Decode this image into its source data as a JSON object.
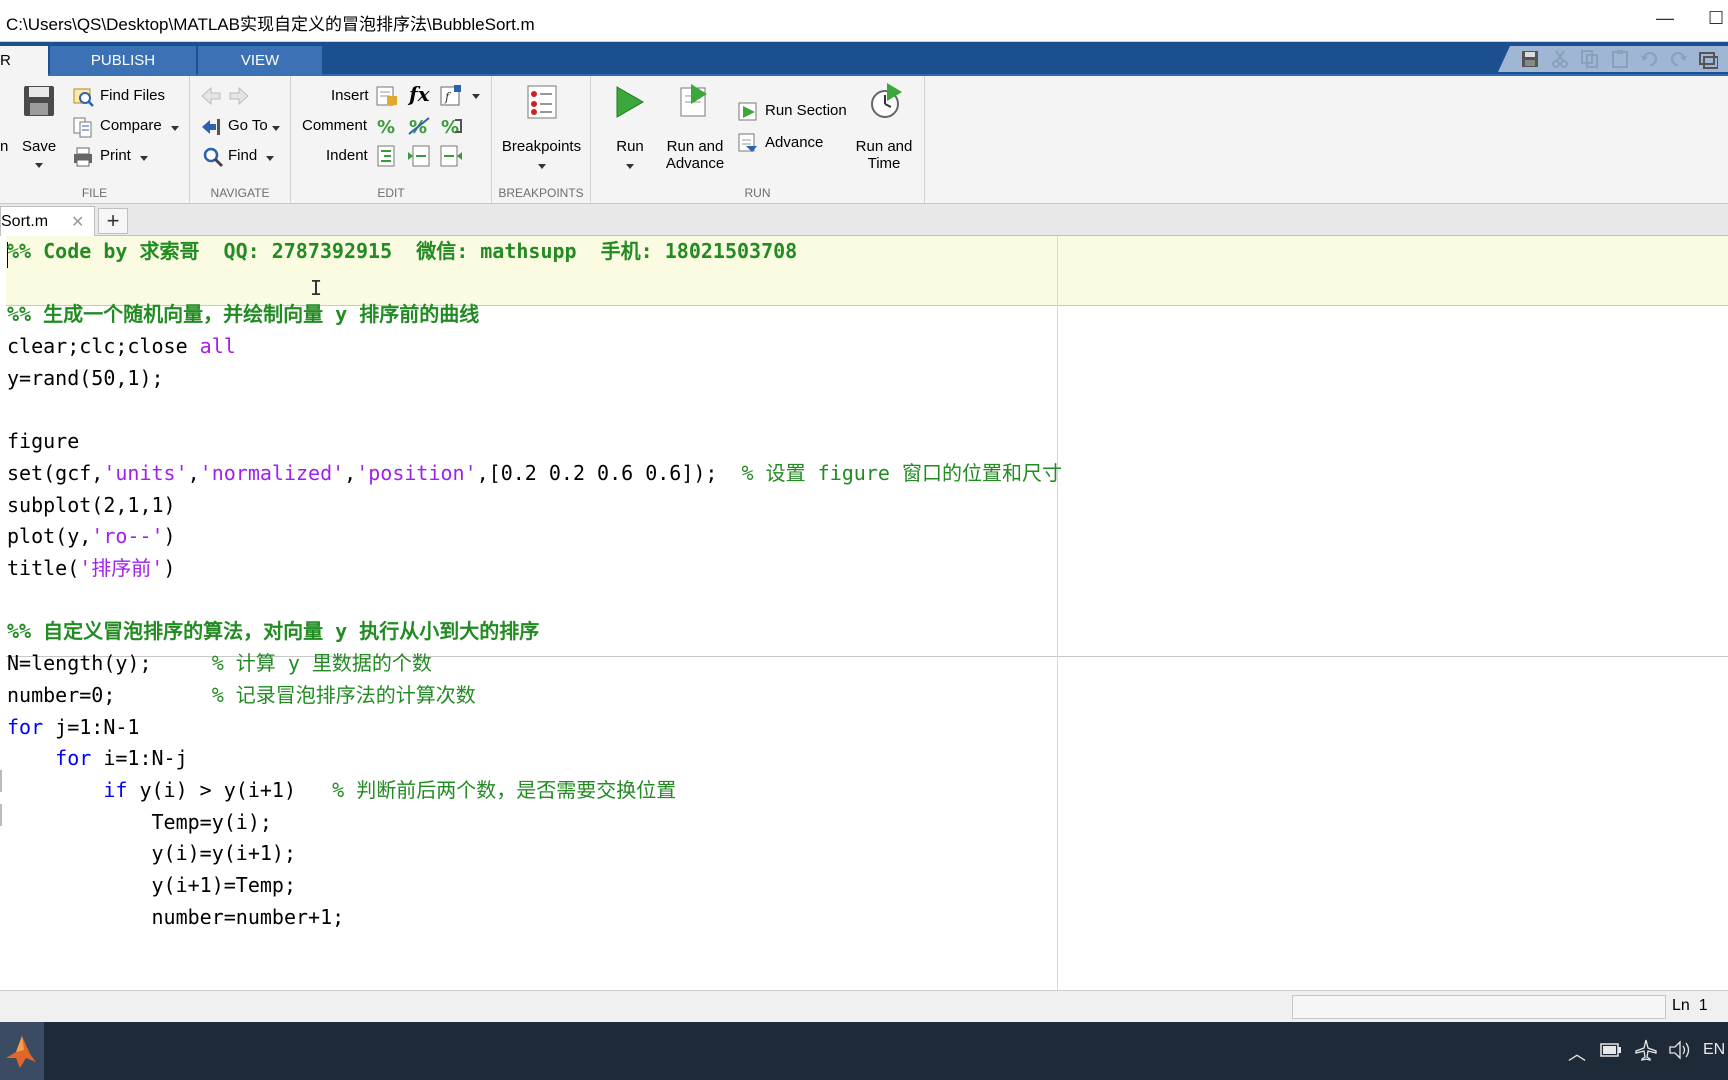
{
  "window": {
    "title": "C:\\Users\\QS\\Desktop\\MATLAB实现自定义的冒泡排序法\\BubbleSort.m",
    "minimize_glyph": "—",
    "maximize_glyph": "☐"
  },
  "ribbon": {
    "tabs": [
      {
        "label": "R",
        "active": true
      },
      {
        "label": "PUBLISH",
        "active": false
      },
      {
        "label": "VIEW",
        "active": false
      }
    ]
  },
  "toolstrip": {
    "file": {
      "label": "FILE",
      "cut_label": "n",
      "save": "Save",
      "find_files": "Find Files",
      "compare": "Compare",
      "print": "Print"
    },
    "navigate": {
      "label": "NAVIGATE",
      "go_to": "Go To",
      "find": "Find"
    },
    "edit": {
      "label": "EDIT",
      "insert": "Insert",
      "comment": "Comment",
      "indent": "Indent",
      "fx": "fx"
    },
    "breakpoints": {
      "label": "BREAKPOINTS",
      "breakpoints": "Breakpoints"
    },
    "run": {
      "label": "RUN",
      "run": "Run",
      "run_and_advance_1": "Run and",
      "run_and_advance_2": "Advance",
      "run_section": "Run Section",
      "advance": "Advance",
      "run_and_time_1": "Run and",
      "run_and_time_2": "Time"
    }
  },
  "editor": {
    "file_tab": "Sort.m",
    "close_glyph": "✕",
    "add_glyph": "+",
    "ibeam_glyph": "I",
    "lines": [
      {
        "segments": [
          {
            "t": "%% Code by 求索哥  QQ: 2787392915  微信: mathsupp  手机: 18021503708",
            "c": "cell"
          }
        ]
      },
      {
        "segments": []
      },
      {
        "segments": [
          {
            "t": "%% 生成一个随机向量，并绘制向量 y 排序前的曲线",
            "c": "cell"
          }
        ]
      },
      {
        "segments": [
          {
            "t": "clear;clc;close ",
            "c": ""
          },
          {
            "t": "all",
            "c": "str"
          }
        ]
      },
      {
        "segments": [
          {
            "t": "y=rand(50,1);",
            "c": ""
          }
        ]
      },
      {
        "segments": []
      },
      {
        "segments": [
          {
            "t": "figure",
            "c": ""
          }
        ]
      },
      {
        "segments": [
          {
            "t": "set(gcf,",
            "c": ""
          },
          {
            "t": "'units'",
            "c": "str"
          },
          {
            "t": ",",
            "c": ""
          },
          {
            "t": "'normalized'",
            "c": "str"
          },
          {
            "t": ",",
            "c": ""
          },
          {
            "t": "'position'",
            "c": "str"
          },
          {
            "t": ",[0.2 0.2 0.6 0.6]);  ",
            "c": ""
          },
          {
            "t": "% 设置 figure 窗口的位置和尺寸",
            "c": "cm"
          }
        ]
      },
      {
        "segments": [
          {
            "t": "subplot(2,1,1)",
            "c": ""
          }
        ]
      },
      {
        "segments": [
          {
            "t": "plot(y,",
            "c": ""
          },
          {
            "t": "'ro--'",
            "c": "str"
          },
          {
            "t": ")",
            "c": ""
          }
        ]
      },
      {
        "segments": [
          {
            "t": "title(",
            "c": ""
          },
          {
            "t": "'排序前'",
            "c": "str"
          },
          {
            "t": ")",
            "c": ""
          }
        ]
      },
      {
        "segments": []
      },
      {
        "segments": [
          {
            "t": "%% 自定义冒泡排序的算法，对向量 y 执行从小到大的排序",
            "c": "cell"
          }
        ]
      },
      {
        "segments": [
          {
            "t": "N=length(y);     ",
            "c": ""
          },
          {
            "t": "% 计算 y 里数据的个数",
            "c": "cm"
          }
        ]
      },
      {
        "segments": [
          {
            "t": "number=0;        ",
            "c": ""
          },
          {
            "t": "% 记录冒泡排序法的计算次数",
            "c": "cm"
          }
        ]
      },
      {
        "segments": [
          {
            "t": "for",
            "c": "kw"
          },
          {
            "t": " j=1:N-1",
            "c": ""
          }
        ]
      },
      {
        "segments": [
          {
            "t": "    ",
            "c": ""
          },
          {
            "t": "for",
            "c": "kw"
          },
          {
            "t": " i=1:N-j",
            "c": ""
          }
        ]
      },
      {
        "segments": [
          {
            "t": "        ",
            "c": ""
          },
          {
            "t": "if",
            "c": "kw"
          },
          {
            "t": " y(i) > y(i+1)   ",
            "c": ""
          },
          {
            "t": "% 判断前后两个数，是否需要交换位置",
            "c": "cm"
          }
        ]
      },
      {
        "segments": [
          {
            "t": "            Temp=y(i);",
            "c": ""
          }
        ]
      },
      {
        "segments": [
          {
            "t": "            y(i)=y(i+1);",
            "c": ""
          }
        ]
      },
      {
        "segments": [
          {
            "t": "            y(i+1)=Temp;",
            "c": ""
          }
        ]
      },
      {
        "segments": [
          {
            "t": "            number=number+1;",
            "c": ""
          }
        ]
      }
    ]
  },
  "status": {
    "position": "Ln  1"
  },
  "taskbar": {
    "chevron": "︿",
    "language": "EN"
  }
}
